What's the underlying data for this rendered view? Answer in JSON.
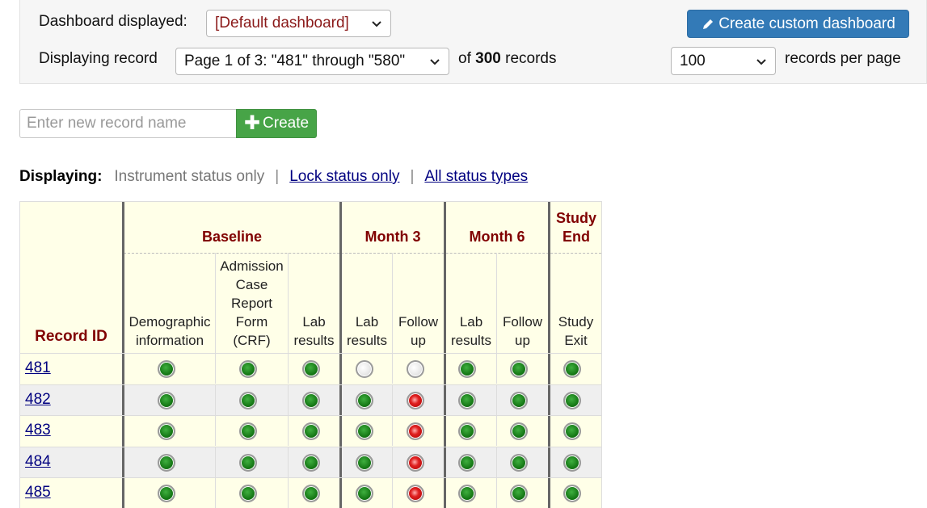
{
  "top": {
    "dashboard_label": "Dashboard displayed:",
    "dashboard_value": "[Default dashboard]",
    "create_dashboard_label": "Create custom dashboard",
    "displaying_label": "Displaying record",
    "page_value": "Page 1 of 3: \"481\" through \"580\"",
    "of_text": "of",
    "total_records": "300",
    "records_text": "records",
    "per_page_value": "100",
    "per_page_label": "records per page"
  },
  "create": {
    "placeholder": "Enter new record name",
    "button_label": "Create"
  },
  "display_filter": {
    "label": "Displaying:",
    "current": "Instrument status only",
    "separator": "|",
    "link_lock": "Lock status only",
    "link_all": "All status types"
  },
  "table": {
    "record_id_header": "Record ID",
    "events": [
      "Baseline",
      "Month 3",
      "Month 6",
      "Study End"
    ],
    "forms": [
      "Demographic information",
      "Admission Case Report Form (CRF)",
      "Lab results",
      "Lab results",
      "Follow up",
      "Lab results",
      "Follow up",
      "Study Exit"
    ],
    "rows": [
      {
        "id": "481",
        "status": [
          "green",
          "green",
          "green",
          "grey",
          "grey",
          "green",
          "green",
          "green"
        ]
      },
      {
        "id": "482",
        "status": [
          "green",
          "green",
          "green",
          "green",
          "red",
          "green",
          "green",
          "green"
        ]
      },
      {
        "id": "483",
        "status": [
          "green",
          "green",
          "green",
          "green",
          "red",
          "green",
          "green",
          "green"
        ]
      },
      {
        "id": "484",
        "status": [
          "green",
          "green",
          "green",
          "green",
          "red",
          "green",
          "green",
          "green"
        ]
      },
      {
        "id": "485",
        "status": [
          "green",
          "green",
          "green",
          "green",
          "red",
          "green",
          "green",
          "green"
        ]
      }
    ]
  },
  "colors": {
    "event_header": "#800000",
    "primary_button": "#337ab7",
    "create_button": "#47a447",
    "table_bg": "#ffffe8",
    "link": "#000080"
  }
}
